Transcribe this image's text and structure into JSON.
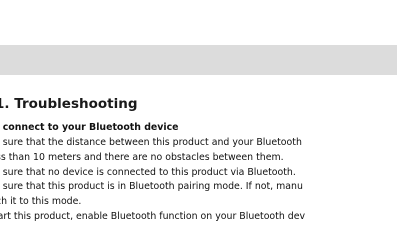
{
  "section": {
    "heading": "1. Troubleshooting"
  },
  "issue": {
    "title": "t connect to your Bluetooth device",
    "lines": [
      "e sure that the distance between this product and your Bluetooth",
      "ss than 10 meters and there are no obstacles between them.",
      "e sure that no device is connected to this product via Bluetooth.",
      "e sure that this product is in Bluetooth pairing mode. If not, manu",
      "ch it to this mode.",
      "tart this product, enable Bluetooth function on your Bluetooth dev"
    ]
  }
}
